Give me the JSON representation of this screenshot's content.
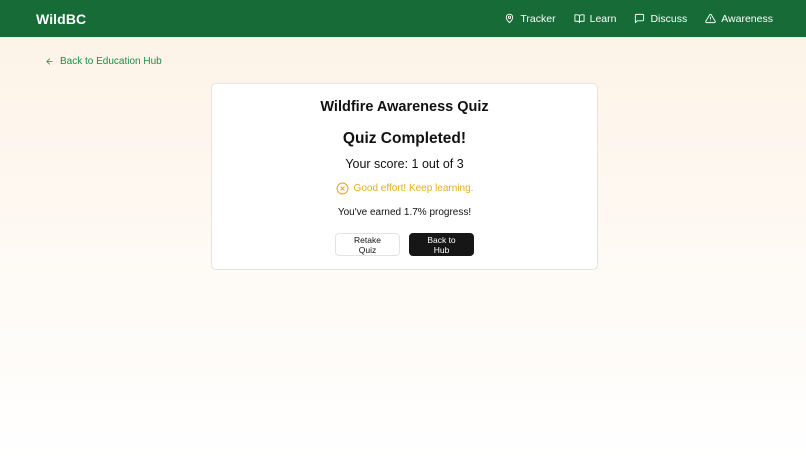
{
  "header": {
    "brand": "WildBC",
    "nav": [
      {
        "label": "Tracker",
        "icon": "map-pin-icon"
      },
      {
        "label": "Learn",
        "icon": "book-open-icon"
      },
      {
        "label": "Discuss",
        "icon": "message-square-icon"
      },
      {
        "label": "Awareness",
        "icon": "alert-triangle-icon"
      }
    ],
    "background_color": "#176b37"
  },
  "back_link": {
    "label": "Back to Education Hub",
    "icon": "arrow-left-icon",
    "color": "#1e8a45"
  },
  "quiz": {
    "title": "Wildfire Awareness Quiz",
    "status": "Quiz Completed!",
    "score_text": "Your score: 1 out of 3",
    "feedback": {
      "text": "Good effort! Keep learning.",
      "icon": "x-circle-icon",
      "color": "#e1b11a"
    },
    "progress_text": "You've earned 1.7% progress!",
    "actions": {
      "retake_label": "Retake Quiz",
      "hub_label": "Back to Hub"
    }
  }
}
